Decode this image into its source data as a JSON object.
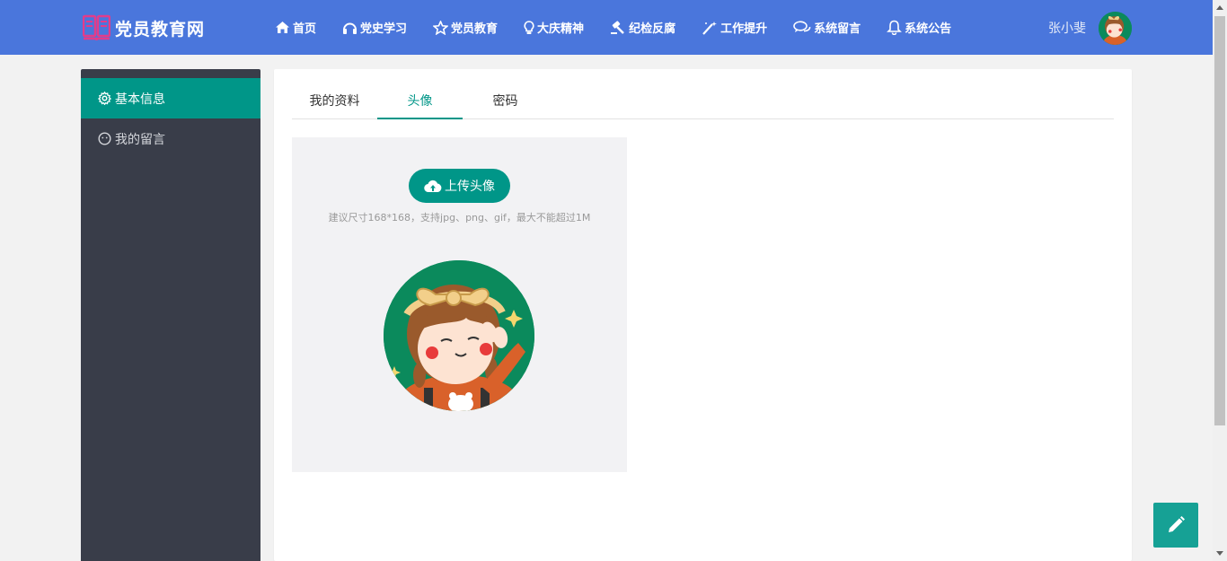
{
  "brand": {
    "title": "党员教育网",
    "accent": "#4a76dc",
    "logo_color": "#e23c8b"
  },
  "nav": [
    {
      "label": "首页",
      "icon": "home-icon"
    },
    {
      "label": "党史学习",
      "icon": "headphones-icon"
    },
    {
      "label": "党员教育",
      "icon": "star-icon"
    },
    {
      "label": "大庆精神",
      "icon": "lightbulb-icon"
    },
    {
      "label": "纪检反腐",
      "icon": "gavel-icon"
    },
    {
      "label": "工作提升",
      "icon": "magic-wand-icon"
    },
    {
      "label": "系统留言",
      "icon": "comments-icon"
    },
    {
      "label": "系统公告",
      "icon": "bell-icon"
    }
  ],
  "user": {
    "name": "张小斐"
  },
  "sidebar": {
    "items": [
      {
        "label": "基本信息",
        "icon": "gear-icon",
        "active": true
      },
      {
        "label": "我的留言",
        "icon": "face-icon",
        "active": false
      }
    ]
  },
  "tabs": [
    {
      "label": "我的资料",
      "active": false
    },
    {
      "label": "头像",
      "active": true
    },
    {
      "label": "密码",
      "active": false
    }
  ],
  "avatar_upload": {
    "button_label": "上传头像",
    "hint": "建议尺寸168*168，支持jpg、png、gif，最大不能超过1M"
  },
  "colors": {
    "primary": "#009688",
    "sidebar_bg": "#393d49"
  }
}
